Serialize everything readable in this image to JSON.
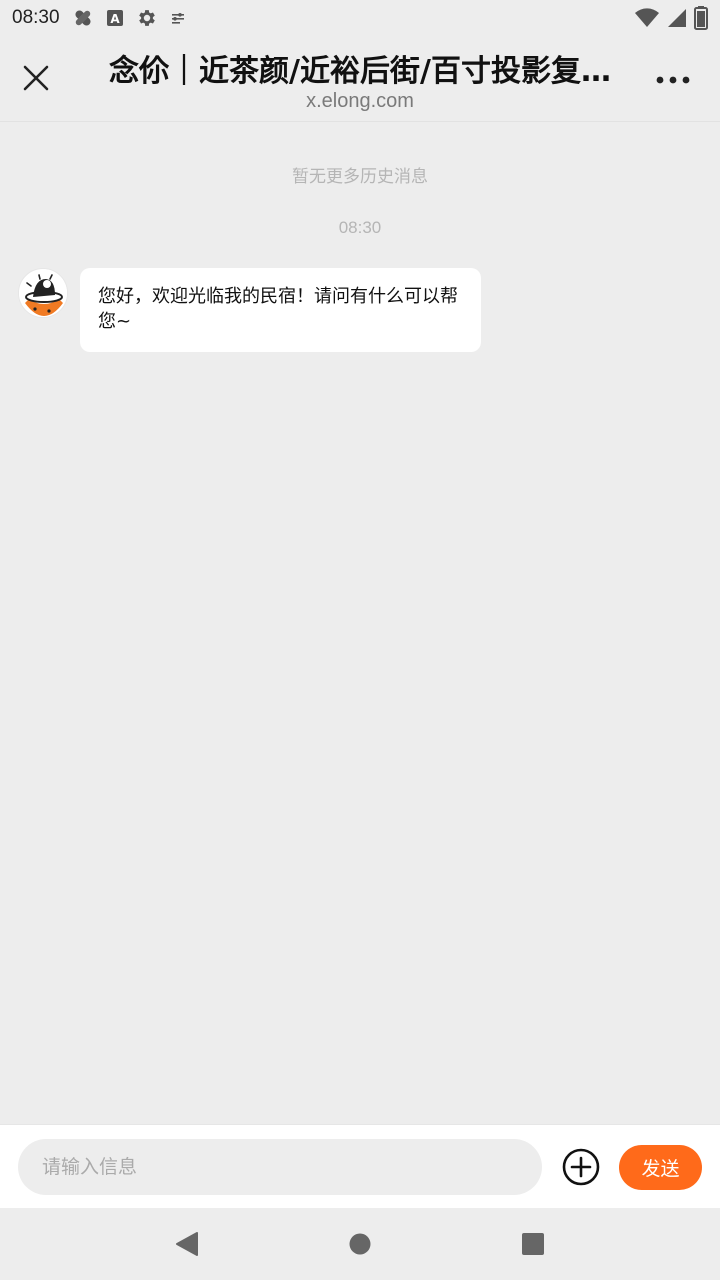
{
  "status_bar": {
    "time": "08:30",
    "left_icons": [
      "bandage-icon",
      "text-a-icon",
      "gear-icon",
      "tune-icon"
    ],
    "right_icons": [
      "wifi-icon",
      "cell-signal-icon",
      "battery-icon"
    ]
  },
  "header": {
    "title": "念伱｜近茶颜/近裕后街/百寸投影复…",
    "subtitle": "x.elong.com",
    "close_icon": "close-icon",
    "more_icon": "more-icon"
  },
  "chat": {
    "history_note": "暂无更多历史消息",
    "timestamp": "08:30",
    "messages": [
      {
        "from": "host",
        "avatar_icon": "host-avatar",
        "text": "您好，欢迎光临我的民宿！请问有什么可以帮您~"
      }
    ]
  },
  "input_bar": {
    "placeholder": "请输入信息",
    "value": "",
    "plus_icon": "plus-circle-icon",
    "send_label": "发送"
  },
  "nav_bar": {
    "icons": [
      "back-icon",
      "home-icon",
      "recents-icon"
    ]
  },
  "colors": {
    "accent": "#ff6a1a",
    "background": "#ededed",
    "bubble": "#ffffff"
  }
}
